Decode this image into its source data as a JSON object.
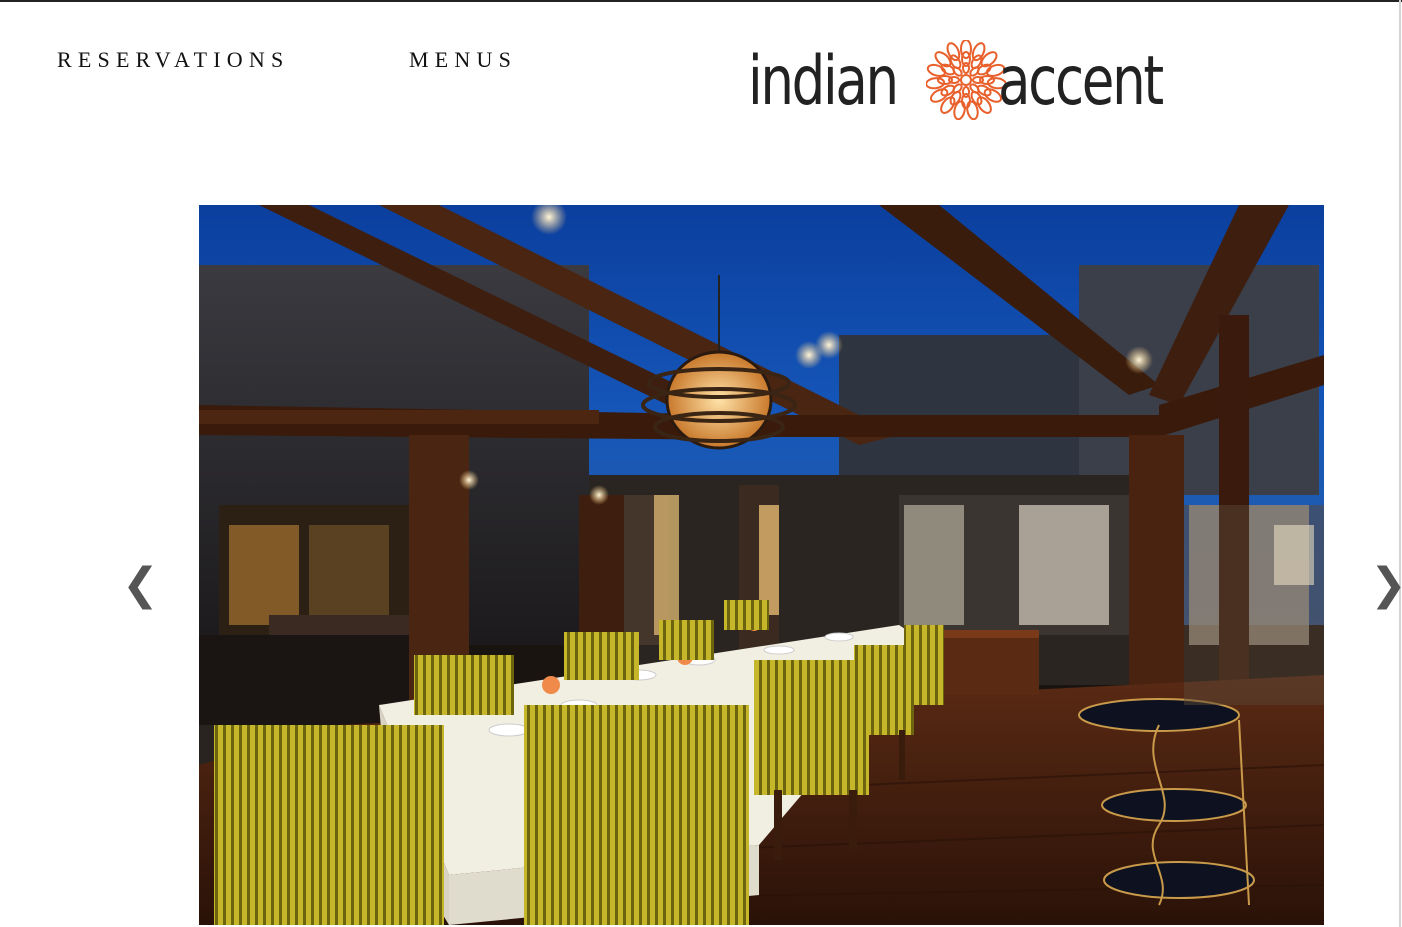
{
  "nav": {
    "items": [
      {
        "label": "RESERVATIONS"
      },
      {
        "label": "MENUS"
      }
    ]
  },
  "logo": {
    "word_left": "indian",
    "word_right": "accent",
    "flower_color": "#e8602c",
    "text_color": "#222222"
  },
  "carousel": {
    "prev_label": "❮",
    "next_label": "❯",
    "image_subject": "restaurant dining room with glass roof, long table with white cloth and yellow striped armchairs"
  },
  "colors": {
    "accent": "#e8602c",
    "nav_text": "#111111",
    "arrow": "#555555"
  }
}
